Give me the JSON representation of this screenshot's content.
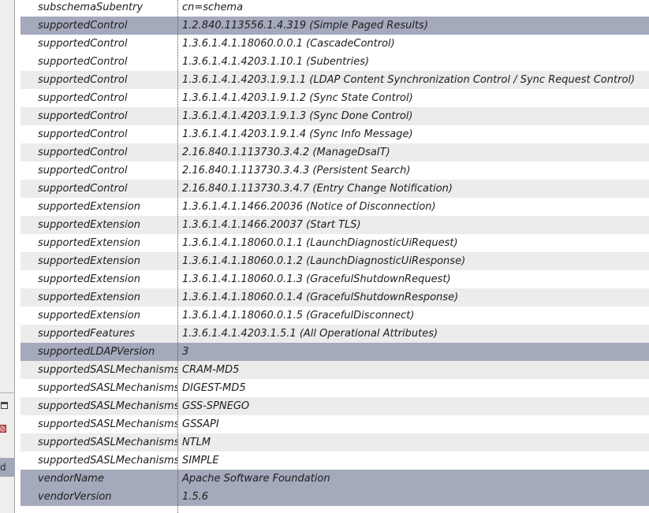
{
  "left_panel": {
    "partial_tab_label": "d"
  },
  "rows": [
    {
      "attribute": "subschemaSubentry",
      "value": "cn=schema",
      "state": "even"
    },
    {
      "attribute": "supportedControl",
      "value": "1.2.840.113556.1.4.319 (Simple Paged Results)",
      "state": "selected"
    },
    {
      "attribute": "supportedControl",
      "value": "1.3.6.1.4.1.18060.0.0.1 (CascadeControl)",
      "state": "even"
    },
    {
      "attribute": "supportedControl",
      "value": "1.3.6.1.4.1.4203.1.10.1 (Subentries)",
      "state": "even"
    },
    {
      "attribute": "supportedControl",
      "value": "1.3.6.1.4.1.4203.1.9.1.1 (LDAP Content Synchronization Control / Sync Request Control)",
      "state": "odd"
    },
    {
      "attribute": "supportedControl",
      "value": "1.3.6.1.4.1.4203.1.9.1.2 (Sync State Control)",
      "state": "even"
    },
    {
      "attribute": "supportedControl",
      "value": "1.3.6.1.4.1.4203.1.9.1.3 (Sync Done Control)",
      "state": "odd"
    },
    {
      "attribute": "supportedControl",
      "value": "1.3.6.1.4.1.4203.1.9.1.4 (Sync Info Message)",
      "state": "even"
    },
    {
      "attribute": "supportedControl",
      "value": "2.16.840.1.113730.3.4.2 (ManageDsaIT)",
      "state": "odd"
    },
    {
      "attribute": "supportedControl",
      "value": "2.16.840.1.113730.3.4.3 (Persistent Search)",
      "state": "even"
    },
    {
      "attribute": "supportedControl",
      "value": "2.16.840.1.113730.3.4.7 (Entry Change Notification)",
      "state": "odd"
    },
    {
      "attribute": "supportedExtension",
      "value": "1.3.6.1.4.1.1466.20036 (Notice of Disconnection)",
      "state": "even"
    },
    {
      "attribute": "supportedExtension",
      "value": "1.3.6.1.4.1.1466.20037 (Start TLS)",
      "state": "odd"
    },
    {
      "attribute": "supportedExtension",
      "value": "1.3.6.1.4.1.18060.0.1.1 (LaunchDiagnosticUiRequest)",
      "state": "even"
    },
    {
      "attribute": "supportedExtension",
      "value": "1.3.6.1.4.1.18060.0.1.2 (LaunchDiagnosticUiResponse)",
      "state": "odd"
    },
    {
      "attribute": "supportedExtension",
      "value": "1.3.6.1.4.1.18060.0.1.3 (GracefulShutdownRequest)",
      "state": "even"
    },
    {
      "attribute": "supportedExtension",
      "value": "1.3.6.1.4.1.18060.0.1.4 (GracefulShutdownResponse)",
      "state": "odd"
    },
    {
      "attribute": "supportedExtension",
      "value": "1.3.6.1.4.1.18060.0.1.5 (GracefulDisconnect)",
      "state": "even"
    },
    {
      "attribute": "supportedFeatures",
      "value": "1.3.6.1.4.1.4203.1.5.1 (All Operational Attributes)",
      "state": "odd"
    },
    {
      "attribute": "supportedLDAPVersion",
      "value": "3",
      "state": "selected"
    },
    {
      "attribute": "supportedSASLMechanisms",
      "value": "CRAM-MD5",
      "state": "odd"
    },
    {
      "attribute": "supportedSASLMechanisms",
      "value": "DIGEST-MD5",
      "state": "even"
    },
    {
      "attribute": "supportedSASLMechanisms",
      "value": "GSS-SPNEGO",
      "state": "odd"
    },
    {
      "attribute": "supportedSASLMechanisms",
      "value": "GSSAPI",
      "state": "even"
    },
    {
      "attribute": "supportedSASLMechanisms",
      "value": "NTLM",
      "state": "odd"
    },
    {
      "attribute": "supportedSASLMechanisms",
      "value": "SIMPLE",
      "state": "even"
    },
    {
      "attribute": "vendorName",
      "value": "Apache Software Foundation",
      "state": "selected"
    },
    {
      "attribute": "vendorVersion",
      "value": "1.5.6",
      "state": "selected"
    }
  ]
}
